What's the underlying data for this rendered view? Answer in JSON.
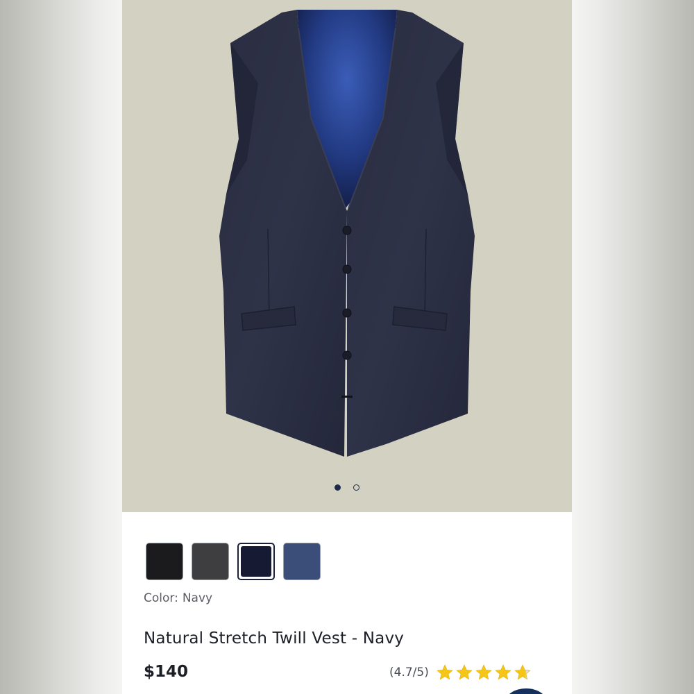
{
  "product": {
    "image_icon": "vest-product-photo",
    "carousel": {
      "total": 2,
      "active": 0
    },
    "swatches": [
      {
        "name": "Black",
        "color": "#1b1b1d"
      },
      {
        "name": "Charcoal",
        "color": "#3e3e40"
      },
      {
        "name": "Navy",
        "color": "#161a33"
      },
      {
        "name": "Blue",
        "color": "#3b4d79"
      }
    ],
    "selected_swatch": 2,
    "color_label": "Color:",
    "color_value": "Navy",
    "title": "Natural Stretch Twill Vest - Navy",
    "price": "$140",
    "rating_text": "(4.7/5)",
    "rating_value": 4.7,
    "rating_max": 5,
    "star_color": "#f5c518"
  }
}
